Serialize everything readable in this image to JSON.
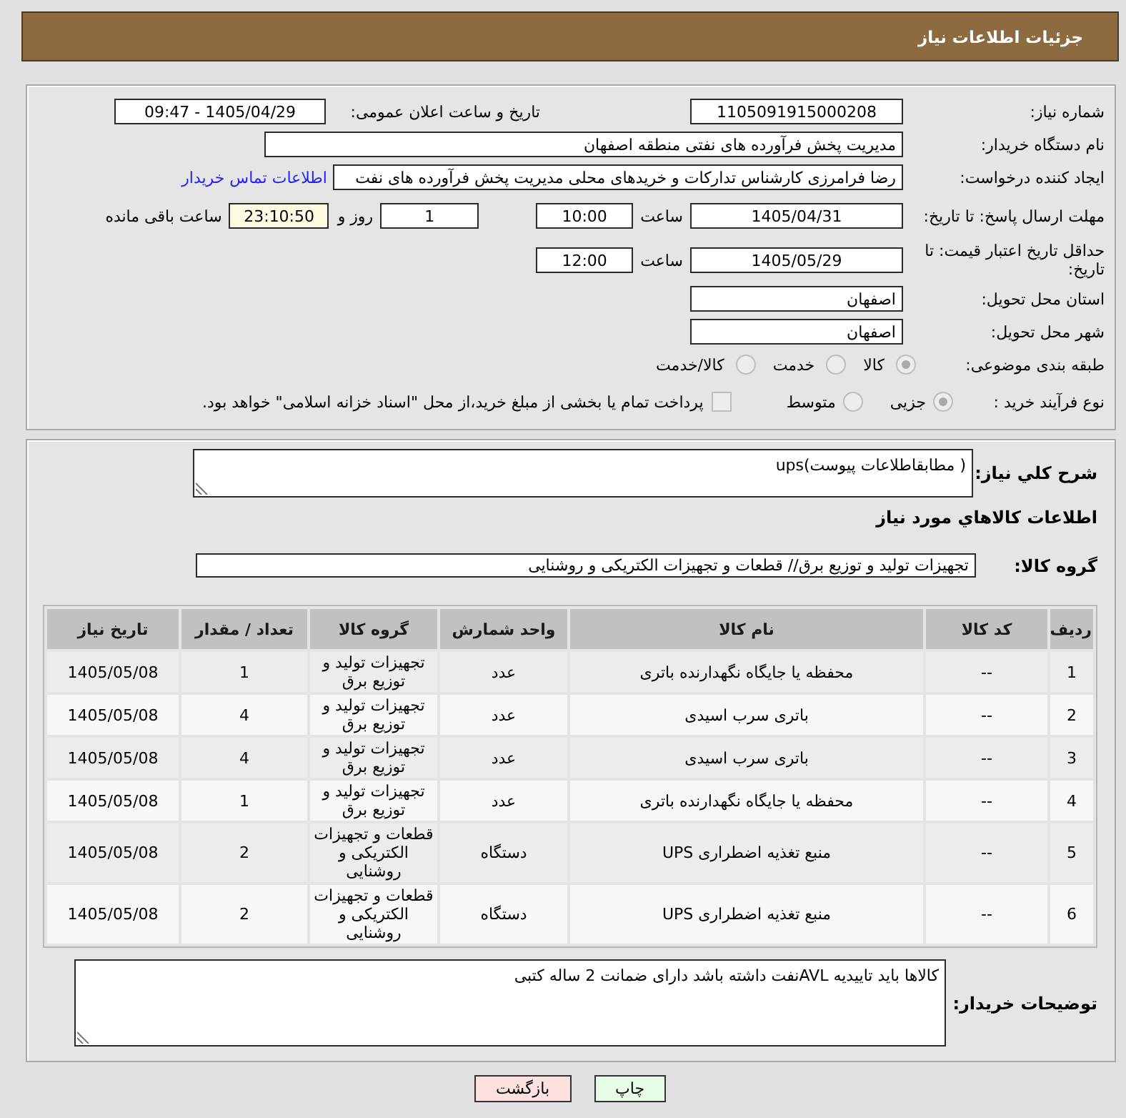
{
  "header": {
    "title": "جزئیات اطلاعات نیاز"
  },
  "details": {
    "need_number": {
      "label": "شماره نیاز:",
      "value": "1105091915000208"
    },
    "announcement": {
      "label": "تاریخ و ساعت اعلان عمومی:",
      "value": "1405/04/29 - 09:47"
    },
    "buyer": {
      "label": "نام دستگاه خریدار:",
      "value": "مدیریت پخش فرآورده های نفتی منطقه اصفهان"
    },
    "requester": {
      "label": "ایجاد کننده درخواست:",
      "value": "رضا فرامرزی کارشناس تدارکات و خریدهای محلی مدیریت پخش فرآورده های نفت",
      "link": "اطلاعات تماس خریدار"
    },
    "reply_deadline": {
      "label": "مهلت ارسال پاسخ: تا تاریخ:",
      "date": "1405/04/31",
      "time_label": "ساعت",
      "time": "10:00",
      "days": "1",
      "days_label": "روز و",
      "remaining": "23:10:50",
      "remaining_label": "ساعت باقی مانده"
    },
    "price_validity": {
      "label": "حداقل تاریخ اعتبار قیمت: تا تاریخ:",
      "date": "1405/05/29",
      "time_label": "ساعت",
      "time": "12:00"
    },
    "province": {
      "label": "استان محل تحویل:",
      "value": "اصفهان"
    },
    "city": {
      "label": "شهر محل تحویل:",
      "value": "اصفهان"
    },
    "category": {
      "label": "طبقه بندی موضوعی:",
      "options": [
        {
          "label": "کالا",
          "selected": true,
          "disabled": true
        },
        {
          "label": "خدمت",
          "selected": false,
          "disabled": true
        },
        {
          "label": "کالا/خدمت",
          "selected": false,
          "disabled": true
        }
      ]
    },
    "purchase_process": {
      "label": "نوع فرآیند خرید :",
      "options": [
        {
          "label": "جزیی",
          "selected": true,
          "disabled": true
        },
        {
          "label": "متوسط",
          "selected": false,
          "disabled": true
        }
      ],
      "treasury_payment": {
        "label": "پرداخت تمام یا بخشی از مبلغ خرید،از محل \"اسناد خزانه اسلامی\" خواهد بود.",
        "checked": false,
        "disabled": true
      }
    }
  },
  "description": {
    "label": "شرح کلي نياز:",
    "value": "( مطابقاطلاعات پیوست)ups"
  },
  "goods": {
    "title": "اطلاعات کالاهاي مورد نياز",
    "group_label": "گروه کالا:",
    "group": "تجهیزات تولید و توزیع برق// قطعات و تجهیزات الکتریکی و روشنایی",
    "table": {
      "columns": [
        "ردیف",
        "کد کالا",
        "نام کالا",
        "واحد شمارش",
        "گروه کالا",
        "تعداد / مقدار",
        "تاریخ نیاز"
      ],
      "rows": [
        [
          "1",
          "--",
          "محفظه یا جایگاه نگهدارنده باتری",
          "عدد",
          "تجهیزات تولید و توزیع برق",
          "1",
          "1405/05/08"
        ],
        [
          "2",
          "--",
          "باتری سرب اسیدی",
          "عدد",
          "تجهیزات تولید و توزیع برق",
          "4",
          "1405/05/08"
        ],
        [
          "3",
          "--",
          "باتری سرب اسیدی",
          "عدد",
          "تجهیزات تولید و توزیع برق",
          "4",
          "1405/05/08"
        ],
        [
          "4",
          "--",
          "محفظه یا جایگاه نگهدارنده باتری",
          "عدد",
          "تجهیزات تولید و توزیع برق",
          "1",
          "1405/05/08"
        ],
        [
          "5",
          "--",
          "منبع تغذیه اضطراری UPS",
          "دستگاه",
          "قطعات و تجهیزات الکتریکی و روشنایی",
          "2",
          "1405/05/08"
        ],
        [
          "6",
          "--",
          "منبع تغذیه اضطراری UPS",
          "دستگاه",
          "قطعات و تجهیزات الکتریکی و روشنایی",
          "2",
          "1405/05/08"
        ]
      ]
    }
  },
  "buyer_notes": {
    "label": "توضیحات خریدار:",
    "value": "کالاها باید تاییدیه AVLنفت داشته باشد دارای ضمانت 2 ساله کتبی"
  },
  "buttons": [
    {
      "label": "چاپ",
      "kind": "print"
    },
    {
      "label": "بازگشت",
      "kind": "back"
    }
  ]
}
